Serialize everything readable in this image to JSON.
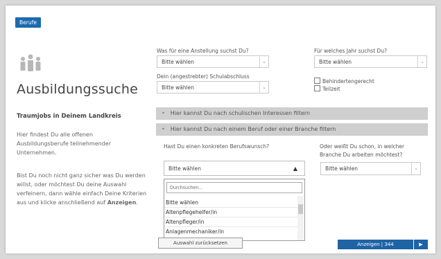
{
  "header": {
    "tab_label": "Berufe"
  },
  "intro": {
    "title": "Ausbildungssuche",
    "subtitle": "Traumjobs in Deinem Landkreis",
    "paragraph1": "Hier findest Du alle offenen Ausbildungsberufe teilnehmender Unternehmen.",
    "paragraph2_start": "Bist Du noch nicht ganz sicher was Du werden willst, oder möchtest Du deine Auswahl verfeinern, dann wähle einfach Deine Kriterien aus und klicke anschließend auf ",
    "paragraph2_bold": "Anzeigen",
    "paragraph2_end": "."
  },
  "filters": {
    "anstellung": {
      "label": "Was für eine Anstellung suchst Du?",
      "value": "Bitte wählen"
    },
    "jahr": {
      "label": "Für welches Jahr suchst Du?",
      "value": "Bitte wählen"
    },
    "schulabschluss": {
      "label": "Dein (angestrebter) Schulabschluss",
      "value": "Bitte wählen"
    },
    "checkboxes": [
      {
        "label": "Behindertengerecht",
        "checked": false
      },
      {
        "label": "Teilzeit",
        "checked": false
      }
    ]
  },
  "sections": {
    "schulisch": "Hier kannst Du nach schulischen Interessen filtern",
    "beruf": "Hier kannst Du nach einem Beruf oder einer Branche filtern",
    "bullet": "•"
  },
  "beruf": {
    "question": "Hast Du einen konkreten Berufswunsch?",
    "value": "Bitte wählen",
    "search_placeholder": "Durchsuchen...",
    "options": [
      "Bitte wählen",
      "Altenpflegehelfer/in",
      "Altenpfleger/in",
      "Anlagenmechaniker/in"
    ]
  },
  "branche": {
    "question_line1": "Oder weißt Du schon, in welcher",
    "question_line2": "Branche Du arbeiten möchtest?",
    "value": "Bitte wählen"
  },
  "actions": {
    "reset_label": "Auswahl zurücksetzen",
    "show_label": "Anzeigen | 344",
    "arrow": "▶"
  },
  "icons": {
    "people": "people-icon",
    "chevron": "chevron-down-icon",
    "caret_up": "▲"
  }
}
